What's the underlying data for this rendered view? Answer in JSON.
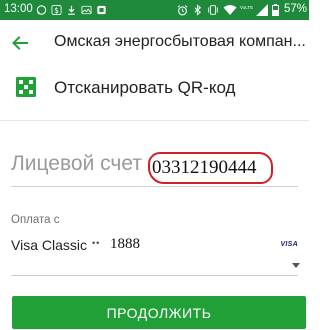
{
  "status_bar": {
    "time": "13:00",
    "battery_percent": "57%",
    "notification_icons": [
      "whatsapp-icon",
      "dollar-icon",
      "download-icon",
      "image-icon",
      "sim-card-icon"
    ],
    "system_icons": [
      "alarm-icon",
      "bluetooth-icon",
      "vibrate-icon",
      "wifi-icon",
      "volte-icon",
      "signal-icon",
      "battery-icon"
    ],
    "volte_label": "VoLTE"
  },
  "toolbar": {
    "back_icon": "arrow-left-icon",
    "title": "Омская энергосбытовая компан..."
  },
  "qr": {
    "icon": "qr-code-icon",
    "label": "Отсканировать QR-код"
  },
  "account": {
    "label": "Лицевой счет",
    "value": "03312190444"
  },
  "payment": {
    "label": "Оплата с",
    "card_name": "Visa Classic",
    "card_dots": "••",
    "card_last4": "1888",
    "card_brand": "VISA"
  },
  "actions": {
    "continue_label": "ПРОДОЛЖИТЬ"
  },
  "colors": {
    "status_bar": "#1f8a3b",
    "accent": "#21a038",
    "annotation": "#d0202a"
  }
}
